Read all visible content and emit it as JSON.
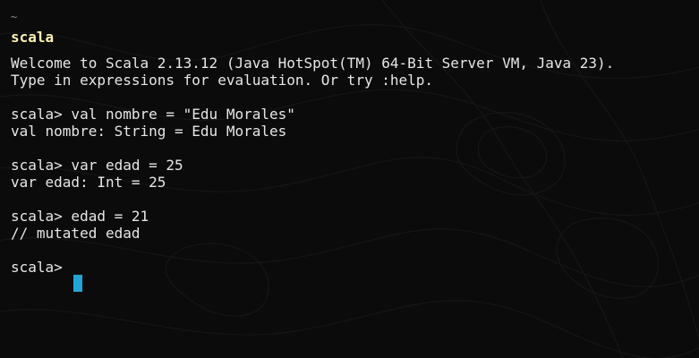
{
  "colors": {
    "background": "#0b0b0b",
    "text": "#e6e6e6",
    "title": "#fbf0b4",
    "cursor": "#22a5d6"
  },
  "terminal": {
    "cwd": "~",
    "title": "scala",
    "welcome_line_1": "Welcome to Scala 2.13.12 (Java HotSpot(TM) 64-Bit Server VM, Java 23).",
    "welcome_line_2": "Type in expressions for evaluation. Or try :help.",
    "entries": [
      {
        "input": "scala> val nombre = \"Edu Morales\"",
        "output": "val nombre: String = Edu Morales"
      },
      {
        "input": "scala> var edad = 25",
        "output": "var edad: Int = 25"
      },
      {
        "input": "scala> edad = 21",
        "output": "// mutated edad"
      }
    ],
    "prompt": "scala>"
  }
}
